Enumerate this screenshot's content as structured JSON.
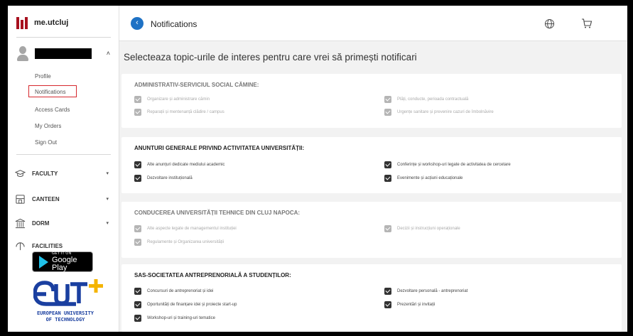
{
  "brand": {
    "name": "me.utcluj"
  },
  "user": {
    "caret": "˄"
  },
  "menu": [
    {
      "label": "Profile"
    },
    {
      "label": "Notifications"
    },
    {
      "label": "Access Cards"
    },
    {
      "label": "My Orders"
    },
    {
      "label": "Sign Out"
    }
  ],
  "sections": [
    {
      "label": "FACULTY",
      "caret": "▾"
    },
    {
      "label": "CANTEEN",
      "caret": "▾"
    },
    {
      "label": "DORM",
      "caret": "▾"
    },
    {
      "label": "FACILITIES"
    }
  ],
  "google_play": {
    "small": "GET IT ON",
    "big": "Google Play"
  },
  "eut": {
    "line1": "EUROPEAN UNIVERSITY",
    "line2": "OF TECHNOLOGY"
  },
  "header": {
    "title": "Notifications",
    "back_icon": "chevron-left-icon",
    "globe_icon": "globe-icon",
    "cart_icon": "cart-icon"
  },
  "main": {
    "title": "Selecteaza topic-urile de interes pentru care vrei să primești notificari"
  },
  "cards": [
    {
      "title": "ADMINISTRATIV-SERVICIUL SOCIAL CĂMINE:",
      "enabled": false,
      "items": [
        "Organizare și administrare cămin",
        "Plăți, conducte, perioada contractuală",
        "Reparații și mentenanță clădire / campus",
        "Urgențe sanitare și prevenire cazuri de îmbolnăvire"
      ]
    },
    {
      "title": "ANUNTURI GENERALE PRIVIND ACTIVITATEA UNIVERSITĂȚII:",
      "enabled": true,
      "items": [
        "Alte anunțuri dedicate mediului academic",
        "Conferințe și workshop-uri legate de activitatea de cercetare",
        "Dezvoltare instituțională",
        "Evenimente și acțiuni educaționale"
      ]
    },
    {
      "title": "CONDUCEREA UNIVERSITĂȚII TEHNICE DIN CLUJ NAPOCA:",
      "enabled": false,
      "items": [
        "Alte aspecte legate de managementul instituției",
        "Decizii și instrucțiuni operaționale",
        "Regulamente și Organizarea universității"
      ]
    },
    {
      "title": "SAS-SOCIETATEA ANTREPRENORIALĂ A STUDENȚILOR:",
      "enabled": true,
      "items": [
        "Concursuri de antreprenoriat și idei",
        "Dezvoltare personală - antreprenoriat",
        "Oportunități de finanțare idei și proiecte start-up",
        "Prezentări și invitații",
        "Workshop-uri și training-uri tematice"
      ]
    }
  ]
}
